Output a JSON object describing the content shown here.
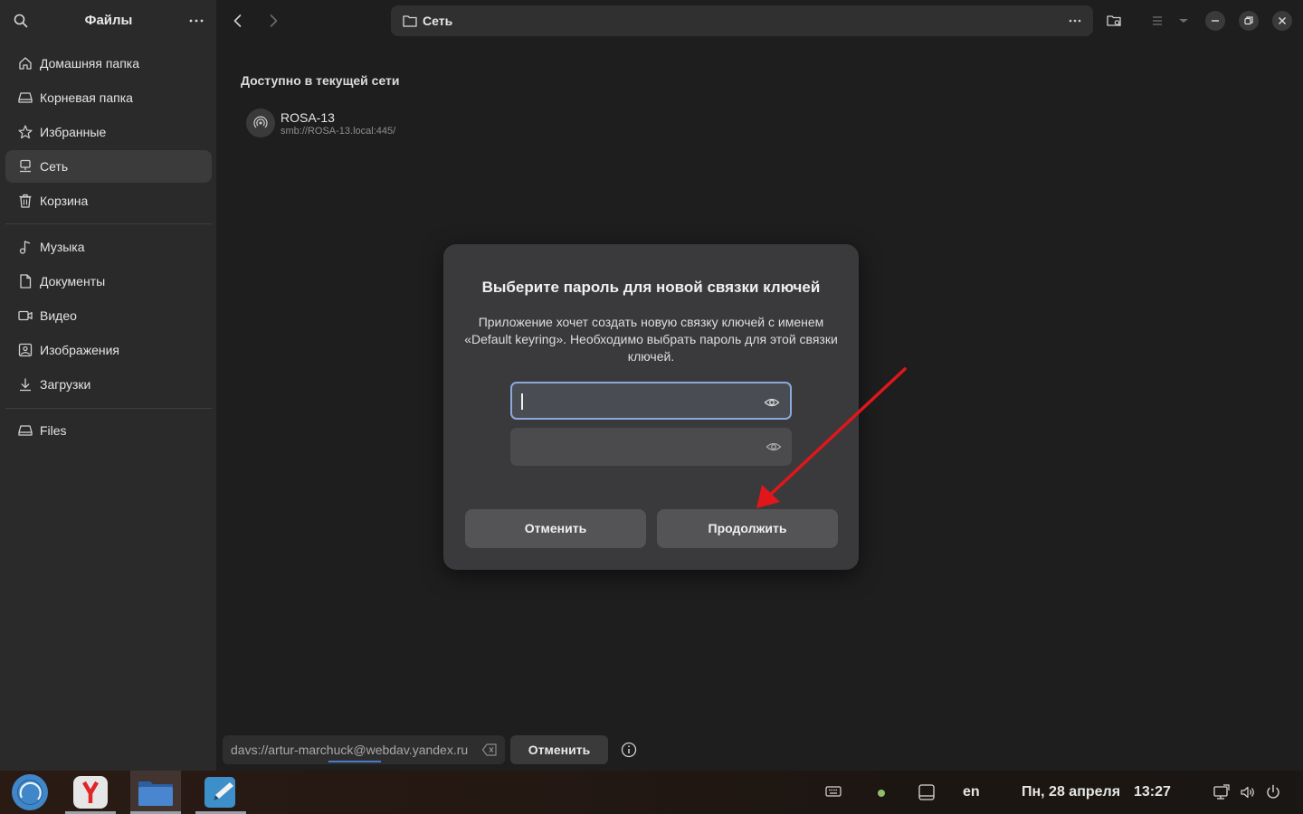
{
  "sidebar": {
    "title": "Файлы",
    "places": [
      {
        "label": "Домашняя папка",
        "icon": "home-icon"
      },
      {
        "label": "Корневая папка",
        "icon": "drive-icon"
      },
      {
        "label": "Избранные",
        "icon": "star-icon"
      },
      {
        "label": "Сеть",
        "icon": "network-icon",
        "active": true
      },
      {
        "label": "Корзина",
        "icon": "trash-icon"
      }
    ],
    "folders": [
      {
        "label": "Музыка",
        "icon": "music-icon"
      },
      {
        "label": "Документы",
        "icon": "document-icon"
      },
      {
        "label": "Видео",
        "icon": "video-icon"
      },
      {
        "label": "Изображения",
        "icon": "image-icon"
      },
      {
        "label": "Загрузки",
        "icon": "download-icon"
      }
    ],
    "devices": [
      {
        "label": "Files",
        "icon": "drive-icon"
      }
    ]
  },
  "header": {
    "path": "Сеть"
  },
  "main": {
    "section_title": "Доступно в текущей сети",
    "network_items": [
      {
        "name": "ROSA-13",
        "uri": "smb://ROSA-13.local:445/"
      }
    ]
  },
  "dialog": {
    "title": "Выберите пароль для новой связки ключей",
    "body": "Приложение хочет создать новую связку ключей с именем «Default keyring». Необходимо выбрать пароль для этой связки ключей.",
    "password_value": "",
    "confirm_value": "",
    "cancel_label": "Отменить",
    "continue_label": "Продолжить"
  },
  "connect_bar": {
    "address": "davs://artur-marchuck@webdav.yandex.ru",
    "cancel_label": "Отменить"
  },
  "taskbar": {
    "keyboard_layout": "en",
    "date": "Пн, 28 апреля",
    "time": "13:27"
  },
  "colors": {
    "focus_border": "#8aa9dc",
    "annotation_arrow": "#e0161b",
    "status_dot": "#8fbf6a"
  }
}
